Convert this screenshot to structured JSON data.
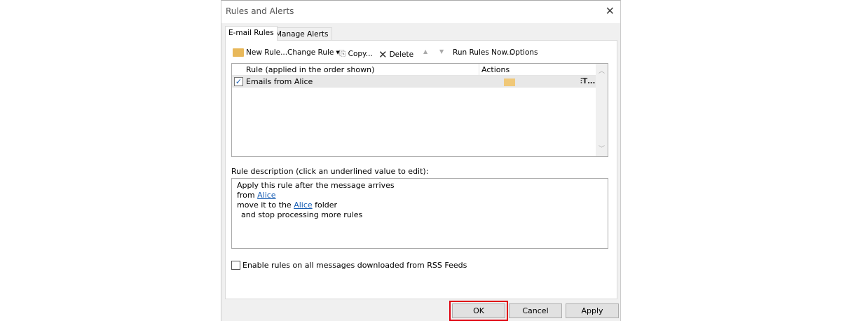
{
  "window": {
    "title": "Rules and Alerts"
  },
  "tabs": [
    {
      "label": "E-mail Rules",
      "active": true
    },
    {
      "label": "Manage Alerts",
      "active": false
    }
  ],
  "toolbar": {
    "new_rule": "New Rule...",
    "change_rule": "Change Rule",
    "copy": "Copy...",
    "delete": "Delete",
    "run_rules_now": "Run Rules Now...",
    "options": "Options"
  },
  "rules_list": {
    "columns": [
      "Rule (applied in the order shown)",
      "Actions"
    ],
    "rows": [
      {
        "name": "Emails from Alice",
        "enabled": true,
        "actions": [
          "move-to-folder-icon",
          "more-actions-icon"
        ]
      }
    ]
  },
  "description": {
    "label": "Rule description (click an underlined value to edit):",
    "line1": "Apply this rule after the message arrives",
    "line2_pre": "from ",
    "line2_link": "Alice",
    "line3_pre": "move it to the ",
    "line3_link": "Alice",
    "line3_post": " folder",
    "line4": "and stop processing more rules"
  },
  "rss": {
    "label": "Enable rules on all messages downloaded from RSS Feeds",
    "checked": false
  },
  "buttons": {
    "ok": "OK",
    "cancel": "Cancel",
    "apply": "Apply"
  },
  "colors": {
    "highlight": "#e0000f",
    "link": "#1a5fb4"
  }
}
